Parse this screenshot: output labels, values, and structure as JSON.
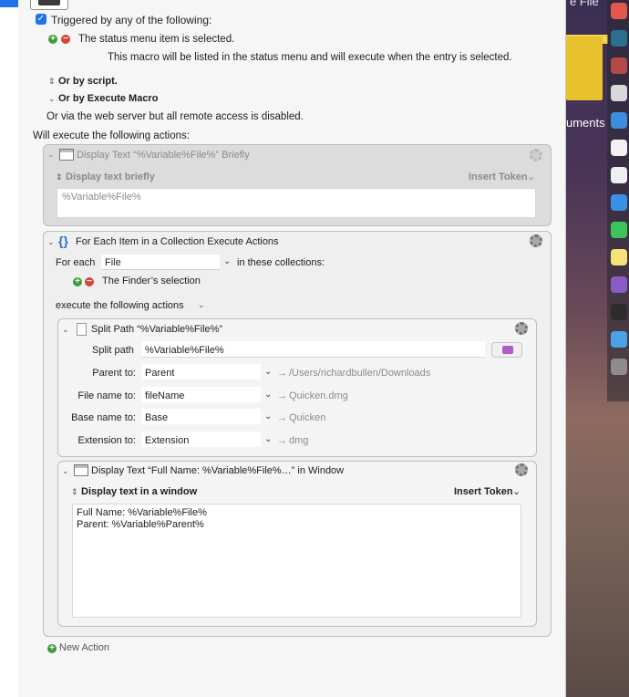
{
  "trigger": {
    "checkbox_label": "Triggered by any of the following:",
    "status_item": "The status menu item is selected.",
    "status_note": "This macro will be listed in the status menu and will execute when the entry is selected.",
    "or_script": "Or by script.",
    "or_execute_macro": "Or by Execute Macro",
    "web_server": "Or via the web server but all remote access is disabled.",
    "will_execute": "Will execute the following actions:"
  },
  "action1": {
    "title": "Display Text “%Variable%File%” Briefly",
    "mode": "Display text briefly",
    "insert_token": "Insert Token",
    "text": "%Variable%File%"
  },
  "action2": {
    "title": "For Each Item in a Collection Execute Actions",
    "for_each_label": "For each",
    "variable": "File",
    "in_collections": "in these collections:",
    "collection": "The Finder’s selection",
    "execute_label": "execute the following actions"
  },
  "split": {
    "title": "Split Path “%Variable%File%”",
    "path_label": "Split path",
    "path_value": "%Variable%File%",
    "rows": [
      {
        "label": "Parent to:",
        "value": "Parent",
        "result": "/Users/richardbullen/Downloads"
      },
      {
        "label": "File name to:",
        "value": "fileName",
        "result": "Quicken.dmg"
      },
      {
        "label": "Base name to:",
        "value": "Base",
        "result": "Quicken"
      },
      {
        "label": "Extension to:",
        "value": "Extension",
        "result": "dmg"
      }
    ]
  },
  "display_window": {
    "title": "Display Text “Full Name: %Variable%File%…” in Window",
    "mode": "Display text in a window",
    "insert_token": "Insert Token",
    "line1": "Full Name: %Variable%File%",
    "line2": "Parent: %Variable%Parent%"
  },
  "new_action": "New Action",
  "desktop": {
    "text_top": "e File",
    "text_documents": "uments"
  },
  "colors": {
    "accent": "#1e73e8",
    "add": "#3c9a3c",
    "remove": "#d9433b"
  }
}
